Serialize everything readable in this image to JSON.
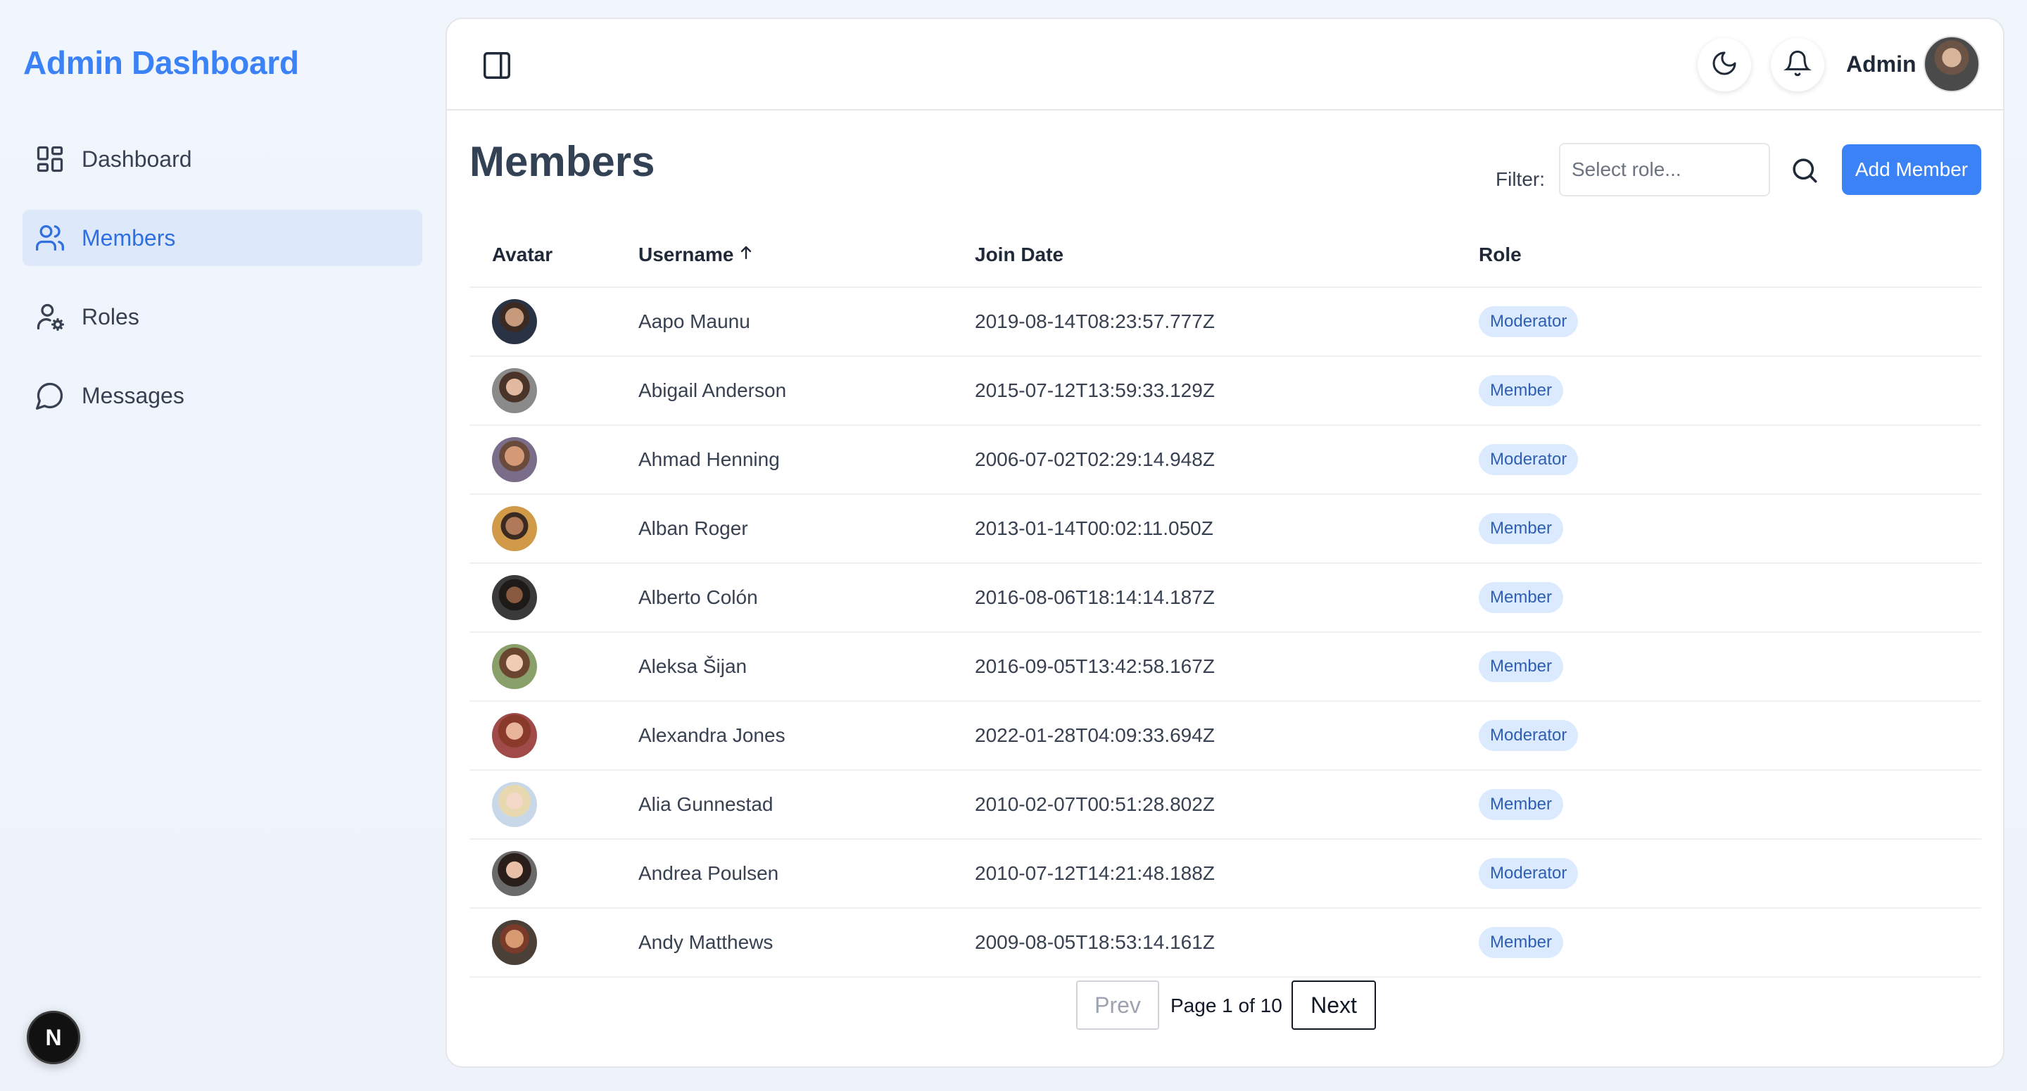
{
  "sidebar": {
    "brand": "Admin Dashboard",
    "items": [
      {
        "label": "Dashboard",
        "icon": "dashboard-grid-icon",
        "active": false
      },
      {
        "label": "Members",
        "icon": "users-icon",
        "active": true
      },
      {
        "label": "Roles",
        "icon": "user-cog-icon",
        "active": false
      },
      {
        "label": "Messages",
        "icon": "message-circle-icon",
        "active": false
      }
    ],
    "badge": "N"
  },
  "header": {
    "user_name": "Admin",
    "icons": [
      "panel-toggle-icon",
      "moon-icon",
      "bell-icon"
    ]
  },
  "page": {
    "title": "Members",
    "filter_label": "Filter:",
    "filter_placeholder": "Select role...",
    "add_button": "Add Member"
  },
  "table": {
    "columns": {
      "avatar": "Avatar",
      "username": "Username",
      "join_date": "Join Date",
      "role": "Role"
    },
    "rows": [
      {
        "username": "Aapo Maunu",
        "join_date": "2019-08-14T08:23:57.777Z",
        "role": "Moderator"
      },
      {
        "username": "Abigail Anderson",
        "join_date": "2015-07-12T13:59:33.129Z",
        "role": "Member"
      },
      {
        "username": "Ahmad Henning",
        "join_date": "2006-07-02T02:29:14.948Z",
        "role": "Moderator"
      },
      {
        "username": "Alban Roger",
        "join_date": "2013-01-14T00:02:11.050Z",
        "role": "Member"
      },
      {
        "username": "Alberto Colón",
        "join_date": "2016-08-06T18:14:14.187Z",
        "role": "Member"
      },
      {
        "username": "Aleksa Šijan",
        "join_date": "2016-09-05T13:42:58.167Z",
        "role": "Member"
      },
      {
        "username": "Alexandra Jones",
        "join_date": "2022-01-28T04:09:33.694Z",
        "role": "Moderator"
      },
      {
        "username": "Alia Gunnestad",
        "join_date": "2010-02-07T00:51:28.802Z",
        "role": "Member"
      },
      {
        "username": "Andrea Poulsen",
        "join_date": "2010-07-12T14:21:48.188Z",
        "role": "Moderator"
      },
      {
        "username": "Andy Matthews",
        "join_date": "2009-08-05T18:53:14.161Z",
        "role": "Member"
      }
    ]
  },
  "pagination": {
    "prev": "Prev",
    "info": "Page 1 of 10",
    "next": "Next"
  },
  "colors": {
    "accent": "#3b82f6",
    "active_bg": "#dde9fb",
    "badge_bg": "#dbeafe",
    "badge_text": "#2f5fb3"
  }
}
